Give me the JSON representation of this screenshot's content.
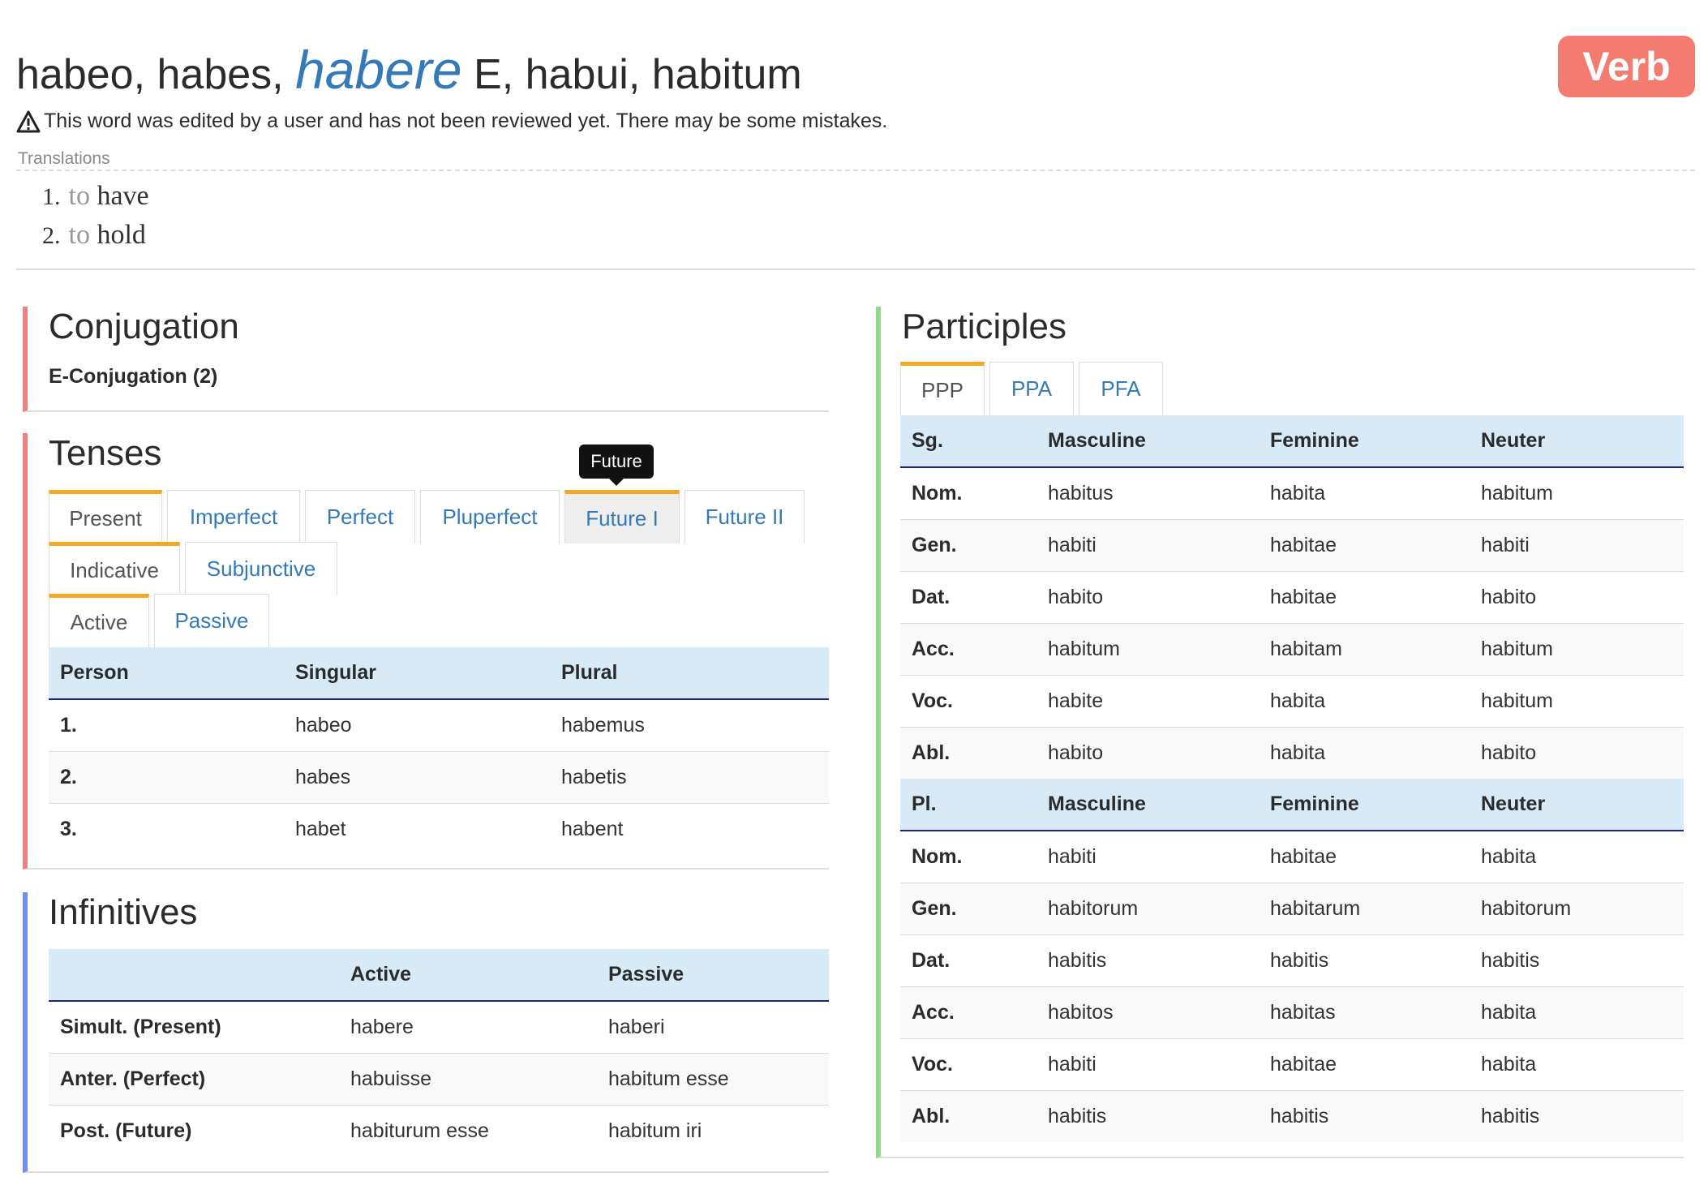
{
  "header": {
    "forms_before": "habeo, habes,",
    "infinitive": "habere",
    "forms_after": "E, habui, habitum",
    "badge": "Verb",
    "warning": "This word was edited by a user and has not been reviewed yet. There may be some mistakes."
  },
  "translations": {
    "label": "Translations",
    "items": [
      {
        "num": "1.",
        "to": "to",
        "word": "have"
      },
      {
        "num": "2.",
        "to": "to",
        "word": "hold"
      }
    ]
  },
  "conjugation": {
    "title": "Conjugation",
    "type": "E-Conjugation (2)"
  },
  "tenses": {
    "title": "Tenses",
    "tooltip": "Future",
    "tense_tabs": [
      "Present",
      "Imperfect",
      "Perfect",
      "Pluperfect",
      "Future I",
      "Future II"
    ],
    "mood_tabs": [
      "Indicative",
      "Subjunctive"
    ],
    "voice_tabs": [
      "Active",
      "Passive"
    ],
    "table": {
      "headers": [
        "Person",
        "Singular",
        "Plural"
      ],
      "rows": [
        [
          "1.",
          "habeo",
          "habemus"
        ],
        [
          "2.",
          "habes",
          "habetis"
        ],
        [
          "3.",
          "habet",
          "habent"
        ]
      ]
    }
  },
  "infinitives": {
    "title": "Infinitives",
    "headers": [
      "",
      "Active",
      "Passive"
    ],
    "rows": [
      [
        "Simult. (Present)",
        "habere",
        "haberi"
      ],
      [
        "Anter. (Perfect)",
        "habuisse",
        "habitum esse"
      ],
      [
        "Post. (Future)",
        "habiturum esse",
        "habitum iri"
      ]
    ]
  },
  "participles": {
    "title": "Participles",
    "tabs": [
      "PPP",
      "PPA",
      "PFA"
    ],
    "sg_headers": [
      "Sg.",
      "Masculine",
      "Feminine",
      "Neuter"
    ],
    "sg_rows": [
      [
        "Nom.",
        "habitus",
        "habita",
        "habitum"
      ],
      [
        "Gen.",
        "habiti",
        "habitae",
        "habiti"
      ],
      [
        "Dat.",
        "habito",
        "habitae",
        "habito"
      ],
      [
        "Acc.",
        "habitum",
        "habitam",
        "habitum"
      ],
      [
        "Voc.",
        "habite",
        "habita",
        "habitum"
      ],
      [
        "Abl.",
        "habito",
        "habita",
        "habito"
      ]
    ],
    "pl_headers": [
      "Pl.",
      "Masculine",
      "Feminine",
      "Neuter"
    ],
    "pl_rows": [
      [
        "Nom.",
        "habiti",
        "habitae",
        "habita"
      ],
      [
        "Gen.",
        "habitorum",
        "habitarum",
        "habitorum"
      ],
      [
        "Dat.",
        "habitis",
        "habitis",
        "habitis"
      ],
      [
        "Acc.",
        "habitos",
        "habitas",
        "habita"
      ],
      [
        "Voc.",
        "habiti",
        "habitae",
        "habita"
      ],
      [
        "Abl.",
        "habitis",
        "habitis",
        "habitis"
      ]
    ]
  },
  "colors": {
    "accent_blue": "#337ab7",
    "badge": "#f47b70",
    "tab_active": "#f5a623",
    "table_header": "#d9eaf7",
    "conj_border": "#f08080",
    "inf_border": "#6f8ef0",
    "part_border": "#8fd98a"
  }
}
